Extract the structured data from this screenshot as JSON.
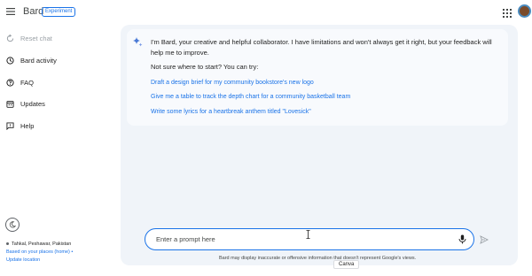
{
  "header": {
    "brand": "Bard",
    "badge": "Experiment"
  },
  "sidebar": {
    "items": [
      {
        "label": "Reset chat",
        "icon": "reset-icon",
        "disabled": true
      },
      {
        "label": "Bard activity",
        "icon": "history-icon"
      },
      {
        "label": "FAQ",
        "icon": "help-circle-icon"
      },
      {
        "label": "Updates",
        "icon": "calendar-icon"
      },
      {
        "label": "Help",
        "icon": "feedback-icon"
      }
    ],
    "location": {
      "place": "Tahkal, Peshawar, Pakistan",
      "basis": "Based on your places (home)",
      "update": "Update location"
    }
  },
  "chat": {
    "intro": "I'm Bard, your creative and helpful collaborator. I have limitations and won't always get it right, but your feedback will help me to improve.",
    "try_label": "Not sure where to start? You can try:",
    "suggestions": [
      "Draft a design brief for my community bookstore's new logo",
      "Give me a table to track the depth chart for a community basketball team",
      "Write some lyrics for a heartbreak anthem titled \"Lovesick\""
    ]
  },
  "prompt": {
    "placeholder": "Enter a prompt here"
  },
  "footer": {
    "disclaimer": "Bard may display inaccurate or offensive information that doesn't represent Google's views.",
    "canva": "Canva"
  },
  "colors": {
    "accent": "#1a73e8",
    "main_bg": "#f0f4f9",
    "card_bg": "#f8fafd"
  }
}
